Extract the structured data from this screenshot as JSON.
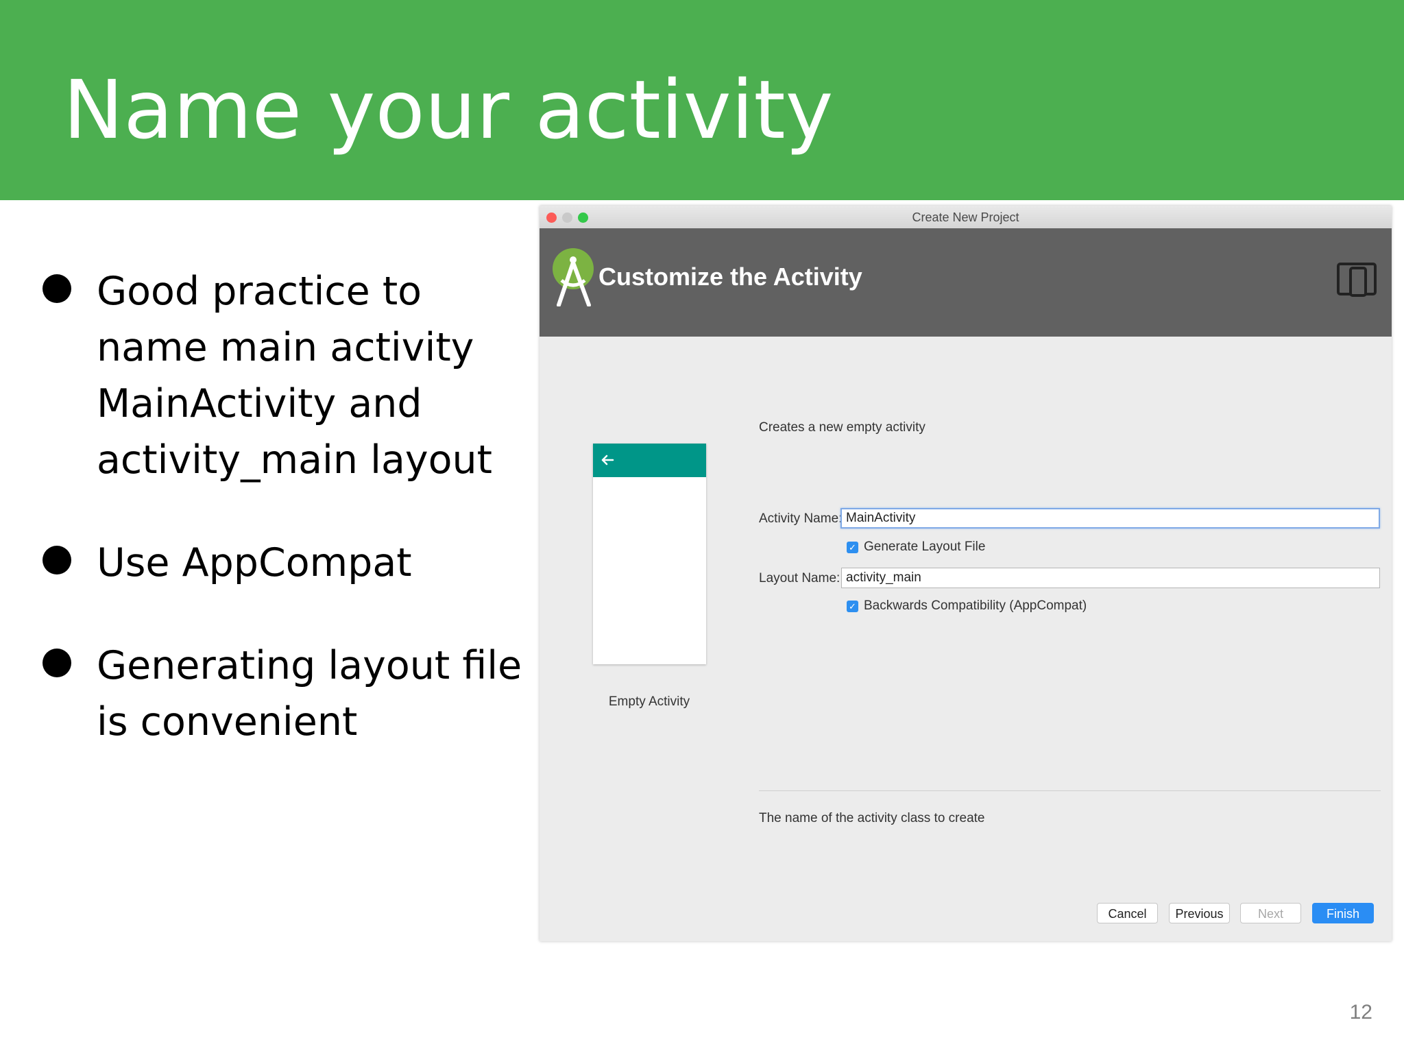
{
  "slide": {
    "title": "Name your activity",
    "bullets": [
      {
        "lines": [
          "Good practice to",
          "name main activity",
          "MainActivity and",
          "activity_main layout"
        ]
      },
      {
        "lines": [
          "Use AppCompat"
        ]
      },
      {
        "lines": [
          "Generating layout file",
          "is convenient"
        ]
      }
    ],
    "page_number": "12",
    "header_color": "#4caf50"
  },
  "window": {
    "title": "Create New Project",
    "banner_title": "Customize the Activity",
    "banner_icon": "android-studio-logo",
    "device_icon": "device-layout-icon",
    "template": {
      "label": "Empty Activity",
      "toolbar_color": "#009688"
    },
    "description": "Creates a new empty activity",
    "fields": {
      "activity_name_label": "Activity Name:",
      "activity_name_value": "MainActivity",
      "generate_layout_label": "Generate Layout File",
      "generate_layout_checked": true,
      "layout_name_label": "Layout Name:",
      "layout_name_value": "activity_main",
      "appcompat_label": "Backwards Compatibility (AppCompat)",
      "appcompat_checked": true
    },
    "hint": "The name of the activity class to create",
    "buttons": {
      "cancel": "Cancel",
      "previous": "Previous",
      "next": "Next",
      "finish": "Finish"
    },
    "accent_color": "#2a8df4"
  }
}
